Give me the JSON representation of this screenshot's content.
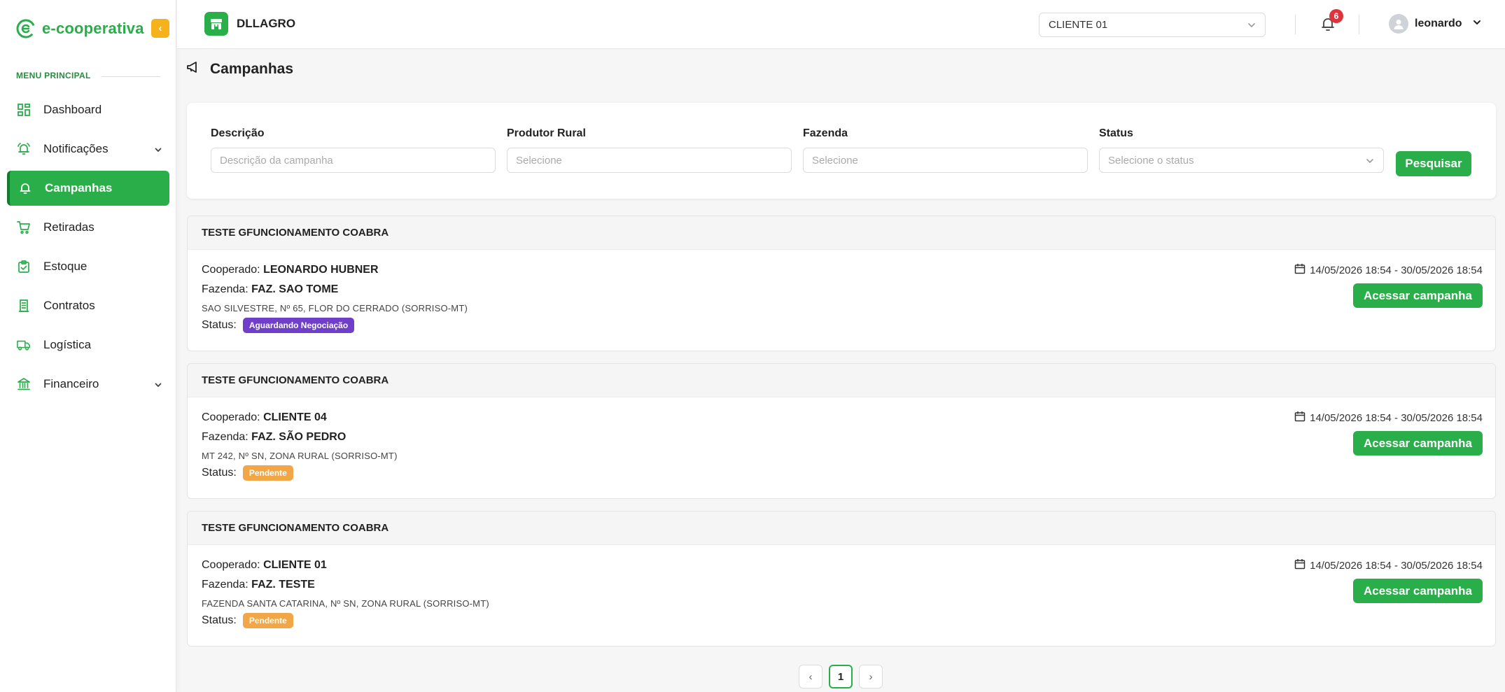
{
  "brand": {
    "name": "e-cooperativa",
    "color": "#2aae4a"
  },
  "sidebar": {
    "menu_title": "MENU PRINCIPAL",
    "items": [
      {
        "label": "Dashboard",
        "icon": "dashboard-grid-icon",
        "expandable": false,
        "active": false
      },
      {
        "label": "Notificações",
        "icon": "bell-ringing-icon",
        "expandable": true,
        "active": false
      },
      {
        "label": "Campanhas",
        "icon": "bell-icon",
        "expandable": false,
        "active": true
      },
      {
        "label": "Retiradas",
        "icon": "cart-icon",
        "expandable": false,
        "active": false
      },
      {
        "label": "Estoque",
        "icon": "clipboard-check-icon",
        "expandable": false,
        "active": false
      },
      {
        "label": "Contratos",
        "icon": "document-icon",
        "expandable": false,
        "active": false
      },
      {
        "label": "Logística",
        "icon": "truck-icon",
        "expandable": false,
        "active": false
      },
      {
        "label": "Financeiro",
        "icon": "bank-icon",
        "expandable": true,
        "active": false
      }
    ]
  },
  "header": {
    "org_name": "DLLAGRO",
    "client_select": "CLIENTE 01",
    "notification_count": "6",
    "user_name": "leonardo"
  },
  "page": {
    "title": "Campanhas"
  },
  "filters": {
    "descricao": {
      "label": "Descrição",
      "placeholder": "Descrição da campanha",
      "value": ""
    },
    "produtor": {
      "label": "Produtor Rural",
      "placeholder": "Selecione",
      "value": ""
    },
    "fazenda": {
      "label": "Fazenda",
      "placeholder": "Selecione",
      "value": ""
    },
    "status": {
      "label": "Status",
      "placeholder": "Selecione o status"
    },
    "search_label": "Pesquisar"
  },
  "labels": {
    "cooperado": "Cooperado:",
    "fazenda": "Fazenda:",
    "status": "Status:",
    "access_button": "Acessar campanha"
  },
  "campaigns": [
    {
      "title": "TESTE GFUNCIONAMENTO COABRA",
      "cooperado": "LEONARDO HUBNER",
      "fazenda": "FAZ. SAO TOME",
      "address": "SAO SILVESTRE, Nº 65, FLOR DO CERRADO (SORRISO-MT)",
      "status": "Aguardando Negociação",
      "status_color": "#6f3fc9",
      "dates": "14/05/2026 18:54 - 30/05/2026 18:54"
    },
    {
      "title": "TESTE GFUNCIONAMENTO COABRA",
      "cooperado": "CLIENTE 04",
      "fazenda": "FAZ. SÃO PEDRO",
      "address": "MT 242, Nº SN, ZONA RURAL (SORRISO-MT)",
      "status": "Pendente",
      "status_color": "#f2a645",
      "dates": "14/05/2026 18:54 - 30/05/2026 18:54"
    },
    {
      "title": "TESTE GFUNCIONAMENTO COABRA",
      "cooperado": "CLIENTE 01",
      "fazenda": "FAZ. TESTE",
      "address": "FAZENDA SANTA CATARINA, Nº SN, ZONA RURAL (SORRISO-MT)",
      "status": "Pendente",
      "status_color": "#f2a645",
      "dates": "14/05/2026 18:54 - 30/05/2026 18:54"
    }
  ],
  "pagination": {
    "prev": "‹",
    "current": "1",
    "next": "›"
  }
}
